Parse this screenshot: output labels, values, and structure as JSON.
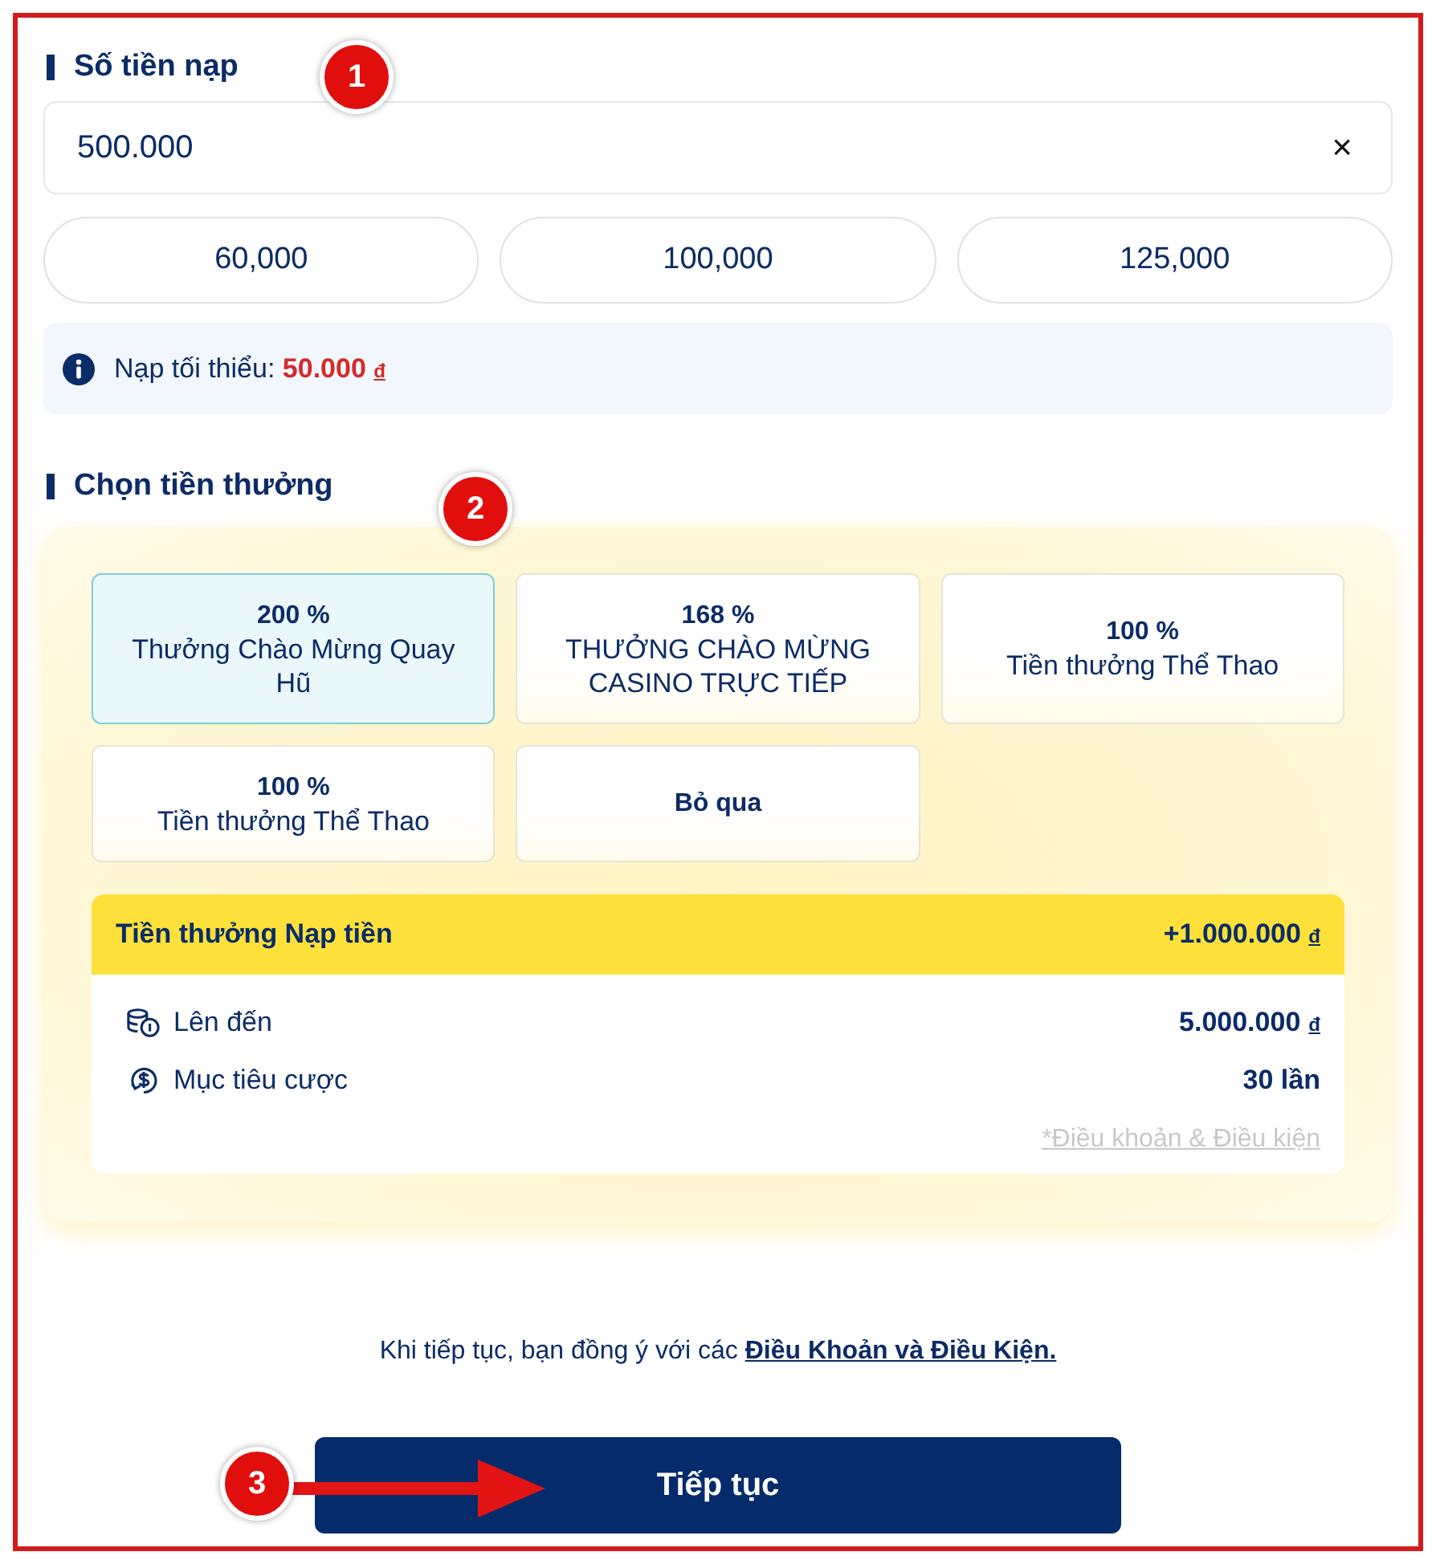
{
  "deposit": {
    "heading": "Số tiền nạp",
    "marker": "1",
    "amount": {
      "value": "500.000",
      "clear": "×"
    },
    "presets": [
      {
        "label": "60,000"
      },
      {
        "label": "100,000"
      },
      {
        "label": "125,000"
      }
    ],
    "notice": {
      "text": "Nạp tối thiểu:",
      "amount": "50.000",
      "currency": "đ"
    }
  },
  "bonus": {
    "heading": "Chọn tiền thưởng",
    "marker": "2",
    "options": [
      {
        "kind": "offer",
        "percent": "200 %",
        "title": "Thưởng Chào Mừng Quay Hũ",
        "selected": true
      },
      {
        "kind": "offer",
        "percent": "168 %",
        "title": "THƯỞNG CHÀO MỪNG CASINO TRỰC TIẾP",
        "selected": false
      },
      {
        "kind": "offer",
        "percent": "100 %",
        "title": "Tiền thưởng Thể Thao",
        "selected": false
      },
      {
        "kind": "offer",
        "percent": "100 %",
        "title": "Tiền thưởng Thể Thao",
        "selected": false
      },
      {
        "kind": "skip",
        "title": "Bỏ qua",
        "selected": false
      }
    ],
    "summary": {
      "title": "Tiền thưởng Nạp tiền",
      "amount": "+1.000.000",
      "currency": "đ",
      "rows": [
        {
          "kind": "coins",
          "label": "Lên đến",
          "value": "5.000.000",
          "currency": "đ"
        },
        {
          "kind": "rollover",
          "label": "Mục tiêu cược",
          "value": "30 lần"
        }
      ],
      "terms": "*Điều khoản & Điều kiện"
    }
  },
  "footer": {
    "consent": "Khi tiếp tục, bạn đồng ý với các",
    "consent_link": "Điều Khoản và Điều Kiện.",
    "button": "Tiếp tục",
    "marker": "3"
  }
}
